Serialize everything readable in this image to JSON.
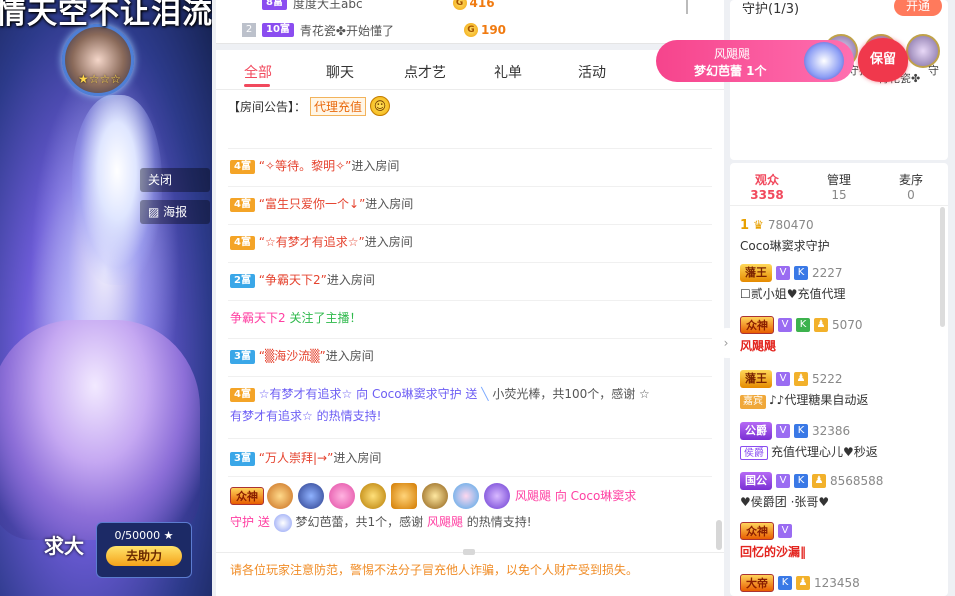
{
  "video": {
    "banner_text": "情天空不让泪流下来",
    "close_label": "关闭",
    "poster_label": "海报",
    "stars": "★☆☆☆",
    "corner_text": "求大",
    "help_progress": "0/50000 ★",
    "help_button": "去助力"
  },
  "top_rank": {
    "rows": [
      {
        "rank": "",
        "badge": "8富",
        "name": "度度大王abc",
        "coins": "416"
      },
      {
        "rank": "2",
        "badge": "10富",
        "name": "青花瓷✤开始懂了",
        "coins": "190"
      }
    ],
    "coin_icon": "G"
  },
  "tabs": [
    {
      "label": "全部"
    },
    {
      "label": "聊天"
    },
    {
      "label": "点才艺"
    },
    {
      "label": "礼单"
    },
    {
      "label": "活动"
    }
  ],
  "notice": {
    "prefix": "【房间公告】：",
    "tag": "代理充值",
    "emoji": "☺"
  },
  "messages": [
    {
      "badge": "4富",
      "name": "“✧等待。黎明✧”",
      "action": "进入房间"
    },
    {
      "badge": "4富",
      "name": "“富生只爱你一个↓”",
      "action": "进入房间"
    },
    {
      "badge": "4富",
      "name": "“☆有梦才有追求☆”",
      "action": "进入房间"
    },
    {
      "badge": "2富",
      "name": "“争霸天下2”",
      "action": "进入房间"
    },
    {
      "user": "争霸天下2",
      "text": "关注了主播！"
    },
    {
      "badge": "3富",
      "name": "“▒海沙流▒”",
      "action": "进入房间"
    },
    {
      "badge": "4富",
      "gift_line1": "☆有梦才有追求☆ 向 Coco琳窦求守护 送",
      "gift_line2": "小荧光棒，共100个，感谢 ☆",
      "gift_line3": "有梦才有追求☆ 的热情支持!"
    },
    {
      "badge": "3富",
      "name": "“万人崇拜|→”",
      "action": "进入房间"
    },
    {
      "gift2_line1": "风飓飓 向 Coco琳窦求",
      "gift2_line2": "守护 送",
      "gift2_gift": "梦幻芭蕾，共1个，感谢",
      "gift2_user": "风飓飓",
      "gift2_tail": "的热情支持!"
    }
  ],
  "footer": {
    "warning": "请各位玩家注意防范，警惕不法分子冒充他人诈骗，以免个人财产受到损失。"
  },
  "guard": {
    "title": "守护(1/3)",
    "open_button": "开通",
    "names": [
      "守护",
      "青花瓷✤",
      "守"
    ]
  },
  "floating_gift": {
    "sender": "风飓飓",
    "gift": "梦幻芭蕾 1个"
  },
  "keep_label": "保留",
  "audience": {
    "tabs": [
      {
        "label": "观众",
        "count": "3358"
      },
      {
        "label": "管理",
        "count": "15"
      },
      {
        "label": "麦序",
        "count": "0"
      }
    ],
    "items": [
      {
        "level": "1",
        "score": "780470",
        "name": "Coco琳窦求守护",
        "level_style": "rank1"
      },
      {
        "level": "藩王",
        "score": "2227",
        "name": "☐贰小姐♥充值代理",
        "level_style": "gold",
        "tag": ""
      },
      {
        "level": "众神",
        "score": "5070",
        "name": "风飓飓",
        "level_style": "big",
        "red": true
      },
      {
        "level": "藩王",
        "score": "5222",
        "name": "♪♪代理糖果自动返",
        "level_style": "gold",
        "tag": "嘉宾"
      },
      {
        "level": "公爵",
        "score": "32386",
        "name": "充值代理心儿♥秒返",
        "level_style": "purple",
        "tag": "侯爵"
      },
      {
        "level": "国公",
        "score": "8568588",
        "name": "♥侯爵团 ·张哥♥",
        "level_style": "purple"
      },
      {
        "level": "众神",
        "score": "",
        "name": "回忆的沙漏‖",
        "level_style": "big",
        "red": true
      },
      {
        "level": "大帝",
        "score": "123458",
        "name": "",
        "level_style": "big"
      }
    ]
  },
  "colors": {
    "accent": "#f1495d",
    "gift_pink": "#f6448c",
    "warning": "#f08c26"
  }
}
